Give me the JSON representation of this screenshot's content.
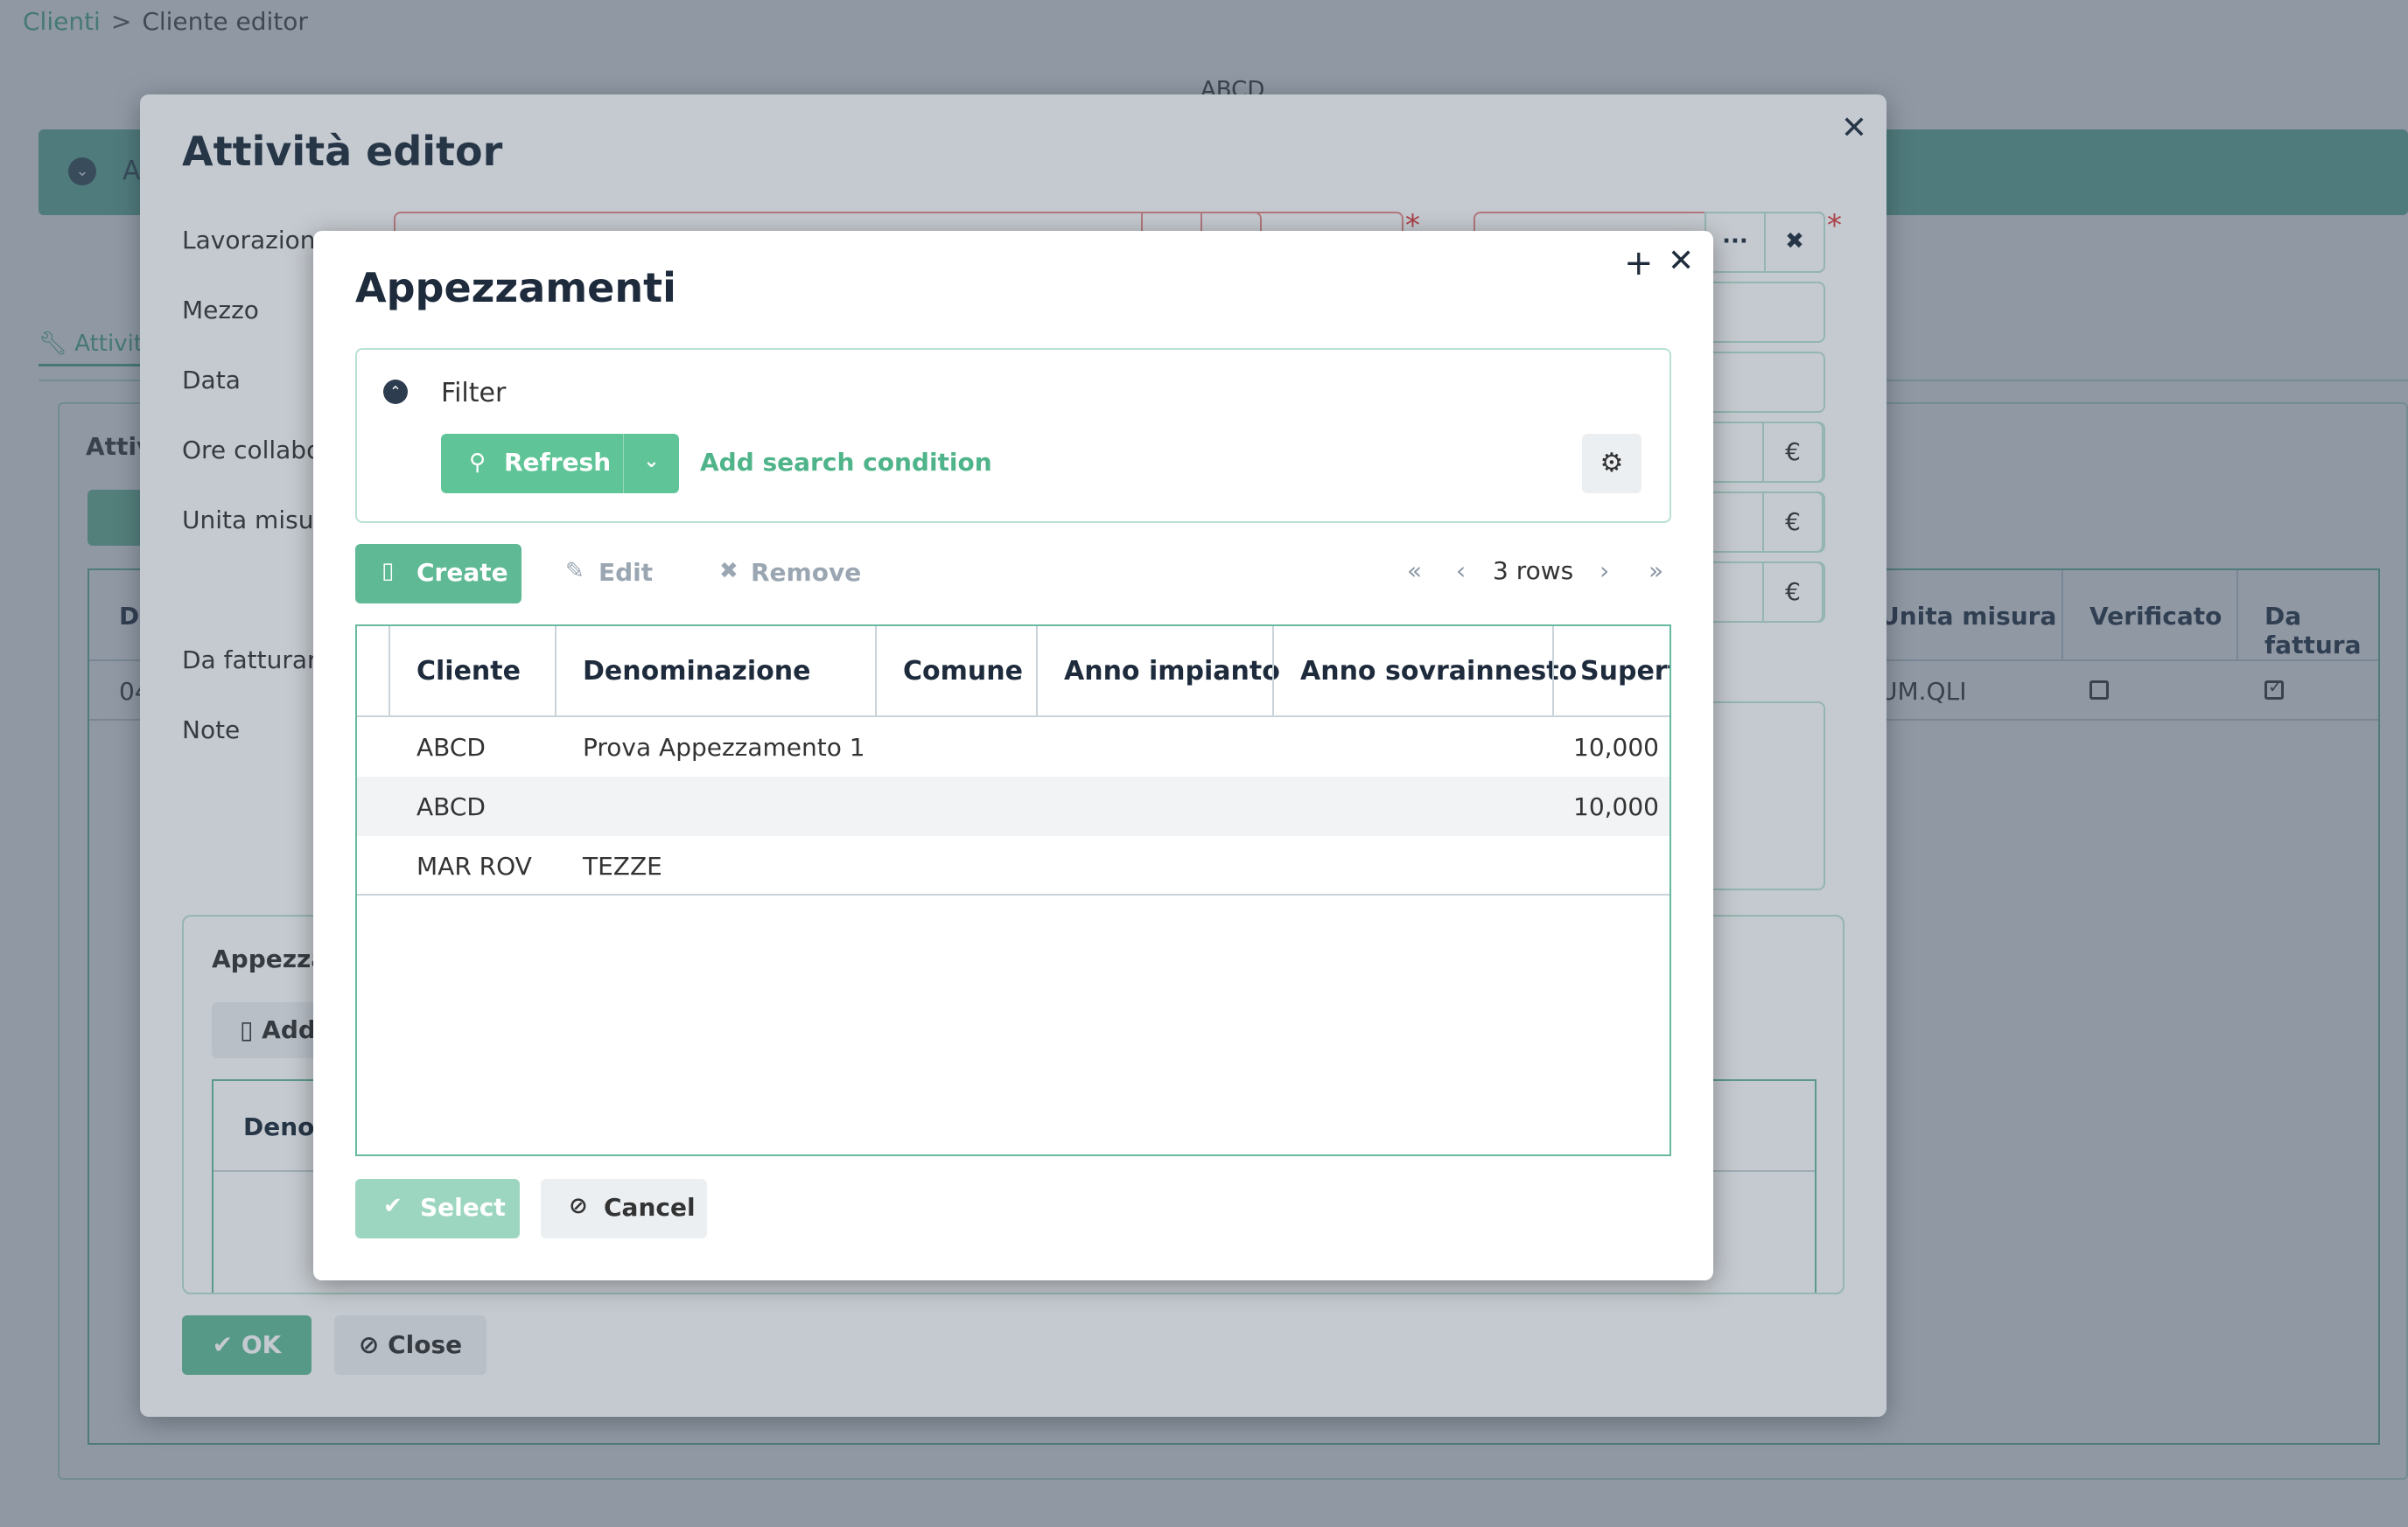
{
  "page": {
    "breadcrumb": {
      "root": "Clienti",
      "separator": ">",
      "current": "Cliente editor"
    },
    "client_name": "ABCD",
    "banner_text": "A",
    "tab_label": "Attivit",
    "panel_title": "Attiv",
    "grid_headers": {
      "first": "Da",
      "unit": "Unita misura",
      "verified": "Verificato",
      "to_invoice": "Da fattura"
    },
    "grid_row": {
      "first": "04",
      "unit": "UM.QLI",
      "verified": false,
      "to_invoice": true
    }
  },
  "editor": {
    "title": "Attività editor",
    "labels": {
      "lavorazione": "Lavorazione",
      "mezzo": "Mezzo",
      "data": "Data",
      "ore": "Ore collabo",
      "unita": "Unita misur",
      "da_fatturare": "Da fatturare",
      "note": "Note"
    },
    "more_button": "···",
    "clear_button": "✖",
    "required_mark": "*",
    "currency": "€",
    "appezzamenti_panel": {
      "title": "Appezzam",
      "add_label": "Add",
      "header": "Denom"
    },
    "ok_label": "OK",
    "close_label": "Close"
  },
  "picker": {
    "title": "Appezzamenti",
    "filter": {
      "label": "Filter",
      "refresh_label": "Refresh",
      "add_condition_label": "Add search condition"
    },
    "toolbar": {
      "create_label": "Create",
      "edit_label": "Edit",
      "remove_label": "Remove"
    },
    "pager": {
      "rows_label": "3 rows"
    },
    "columns": [
      "Cliente",
      "Denominazione",
      "Comune",
      "Anno impianto",
      "Anno sovrainnesto",
      "Superfi"
    ],
    "rows": [
      {
        "cliente": "ABCD",
        "denominazione": "Prova Appezzamento 1",
        "comune": "",
        "anno_impianto": "",
        "anno_sovrainnesto": "",
        "superficie": "10,000"
      },
      {
        "cliente": "ABCD",
        "denominazione": "",
        "comune": "",
        "anno_impianto": "",
        "anno_sovrainnesto": "",
        "superficie": "10,000"
      },
      {
        "cliente": "MAR ROV",
        "denominazione": "TEZZE",
        "comune": "",
        "anno_impianto": "",
        "anno_sovrainnesto": "",
        "superficie": ""
      }
    ],
    "select_label": "Select",
    "cancel_label": "Cancel"
  },
  "colors": {
    "accent": "#5fc497",
    "accent_dark": "#5fb995",
    "border": "#b9e1d1",
    "required": "#d93b3b",
    "text": "#1e2b3c"
  }
}
